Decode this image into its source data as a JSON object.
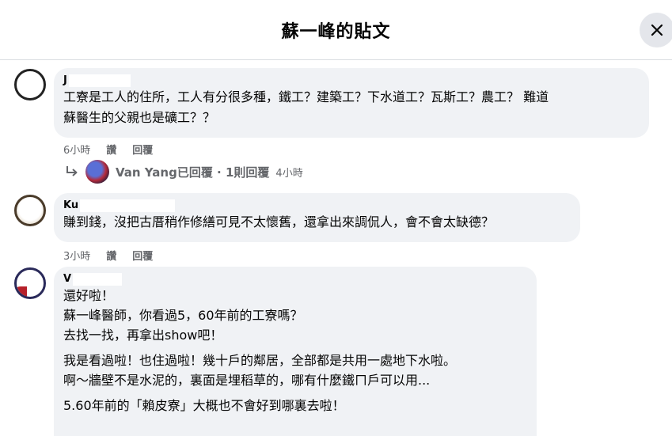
{
  "header": {
    "title": "蘇一峰的貼文",
    "close_icon": "close-icon"
  },
  "comments": [
    {
      "author": "J",
      "text": "工寮是工人的住所，工人有分很多種，鐵工？建築工？下水道工？瓦斯工？農工？ 難道\n蘇醫生的父親也是礦工？？",
      "time": "6小時",
      "like_label": "讚",
      "reply_label": "回覆"
    },
    {
      "author": "Ku",
      "text": "賺到錢，沒把古厝稍作修繕可見不太懷舊，還拿出來調侃人，會不會太缺德？",
      "time": "3小時",
      "like_label": "讚",
      "reply_label": "回覆"
    },
    {
      "author": "V",
      "paragraphs": [
        "還好啦！\n蘇一峰醫師，你看過5，60年前的工寮嗎？\n去找一找，再拿出show吧！",
        "我是看過啦！也住過啦！幾十戶的鄰居，全部都是共用一處地下水啦。\n啊～牆壁不是水泥的，裏面是埋稻草的，哪有什麼鐵ㄇ戶可以用...",
        "5.60年前的「賴皮寮」大概也不會好到哪裏去啦！"
      ]
    }
  ],
  "reply_summary": {
    "text": "Van Yang已回覆 · 1則回覆",
    "time": "4小時",
    "arrow_icon": "reply-arrow-icon"
  }
}
